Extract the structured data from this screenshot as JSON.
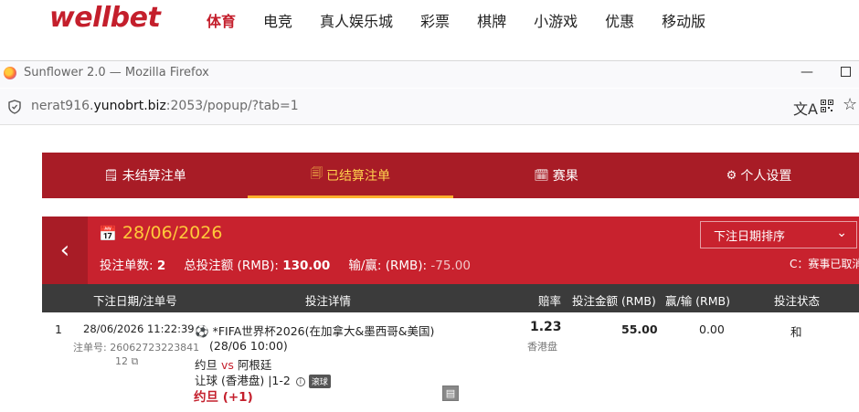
{
  "site": {
    "logo": "wellbet",
    "nav": [
      "体育",
      "电竞",
      "真人娱乐城",
      "彩票",
      "棋牌",
      "小游戏",
      "优惠",
      "移动版"
    ],
    "active_nav": "体育"
  },
  "browser": {
    "window_title": "Sunflower 2.0 — Mozilla Firefox",
    "url_prefix": "nerat916.",
    "url_domain": "yunobrt.biz",
    "url_suffix": ":2053/popup/?tab=1"
  },
  "tabs": [
    {
      "icon": "🗒",
      "label": "未结算注单"
    },
    {
      "icon": "🗐",
      "label": "已结算注单"
    },
    {
      "icon": "🗓",
      "label": "赛果"
    },
    {
      "icon": "⚙",
      "label": "个人设置"
    }
  ],
  "summary": {
    "back_icon": "‹",
    "date": "28/06/2026",
    "bet_count_label": "投注单数:",
    "bet_count": "2",
    "total_label": "总投注额 (RMB):",
    "total": "130.00",
    "winloss_label": "输/赢: (RMB):",
    "winloss": "-75.00",
    "sort_label": "下注日期排序",
    "cancel_note": "C：赛事已取消"
  },
  "table": {
    "headers": [
      "下注日期/注单号",
      "投注详情",
      "赔率",
      "投注金额 (RMB)",
      "赢/输 (RMB)",
      "投注状态"
    ],
    "rows": [
      {
        "index": "1",
        "datetime": "28/06/2026 11:22:39",
        "bet_no_label": "注单号: 26062723223841",
        "bet_no_tail": "12",
        "league": "*FIFA世界杯2026(在加拿大&墨西哥&美国)",
        "match_time": "(28/06 10:00)",
        "home": "约旦",
        "vs": "vs",
        "away": "阿根廷",
        "market": "让球 (香港盘)",
        "score": "1-2",
        "status_tag": "滚球",
        "selection": "约旦 (+1)",
        "odds": "1.23",
        "odds_type": "香港盘",
        "stake": "55.00",
        "winloss": "0.00",
        "status": "和"
      }
    ]
  },
  "colors": {
    "brand_red": "#c41f2c",
    "tab_bg": "#a81c26",
    "summary_bg": "#c8222e",
    "active_tab": "#ffd24d",
    "header_bg": "#3b3b3b"
  }
}
